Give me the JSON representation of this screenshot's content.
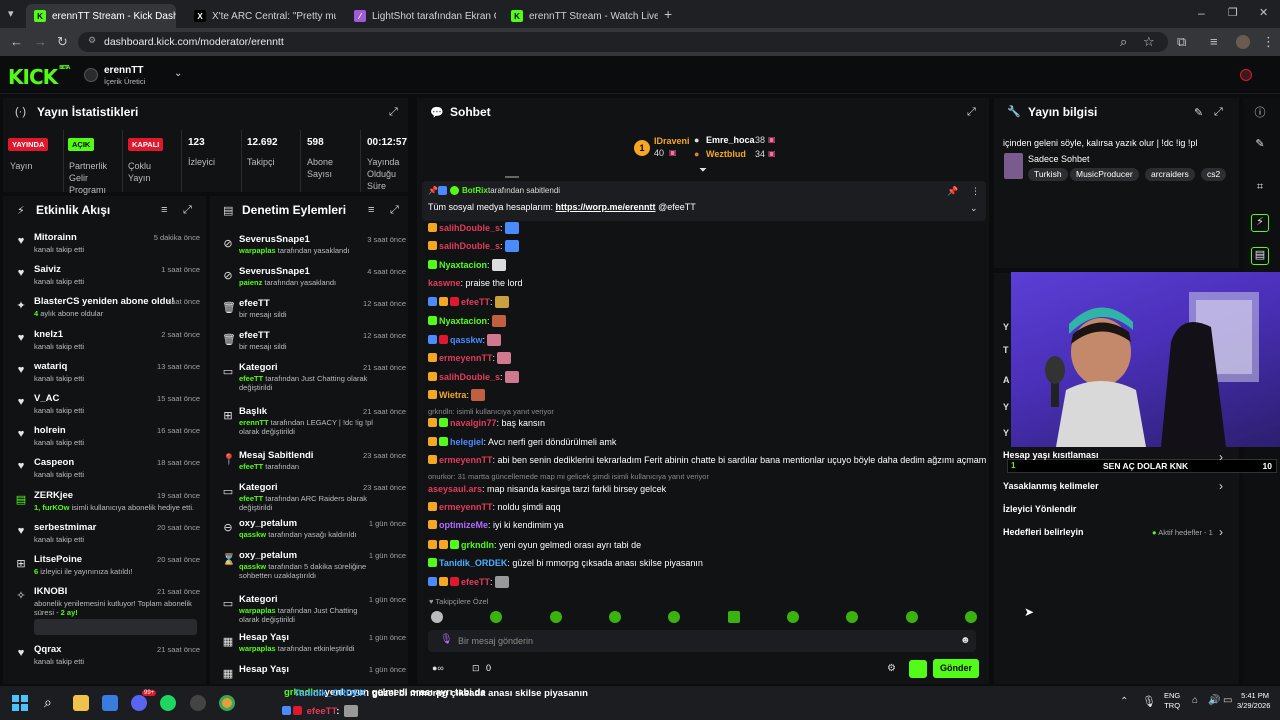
{
  "browser": {
    "tabs": [
      {
        "label": "erennTT Stream - Kick Dashbo",
        "favicon": "kick-icon",
        "active": true
      },
      {
        "label": "X'te ARC Central: \"Pretty much",
        "favicon": "x-icon",
        "active": false
      },
      {
        "label": "LightShot tarafından Ekran Gön",
        "favicon": "lightshot-icon",
        "active": false
      },
      {
        "label": "erennTT Stream - Watch Live o",
        "favicon": "kick-icon",
        "active": false
      }
    ],
    "url": "dashboard.kick.com/moderator/erenntt"
  },
  "header": {
    "logo": "KICK",
    "logo_super": "BETA",
    "channel_name": "erennTT",
    "channel_role": "İçerik Üretici"
  },
  "stats": {
    "title": "Yayın İstatistikleri",
    "items": [
      {
        "badge": "YAYINDA",
        "label": "Yayın",
        "badge_color": "#e0182d"
      },
      {
        "badge": "AÇIK",
        "label": "Partnerlik Gelir Programı",
        "badge_color": "#53fc18"
      },
      {
        "badge": "KAPALI",
        "label": "Çoklu Yayın",
        "badge_color": "#e0182d"
      },
      {
        "value": "123",
        "label": "İzleyici"
      },
      {
        "value": "12.692",
        "label": "Takipçi"
      },
      {
        "value": "598",
        "label": "Abone Sayısı"
      },
      {
        "value": "00:12:57",
        "label": "Yayında Olduğu Süre"
      }
    ]
  },
  "activity": {
    "title": "Etkinlik Akışı",
    "items": [
      {
        "icon": "heart-icon",
        "name": "Mitorainn",
        "sub": "kanalı takip etti",
        "time": "5 dakika önce"
      },
      {
        "icon": "heart-icon",
        "name": "Saiviz",
        "sub": "kanalı takip etti",
        "time": "1 saat önce"
      },
      {
        "icon": "star-icon",
        "name": "BlasterCS yeniden abone oldu!",
        "sub_count": "4",
        "sub": " aylık abone oldular",
        "time": "1 saat önce"
      },
      {
        "icon": "heart-icon",
        "name": "knelz1",
        "sub": "kanalı takip etti",
        "time": "2 saat önce"
      },
      {
        "icon": "heart-icon",
        "name": "watariq",
        "sub": "kanalı takip etti",
        "time": "13 saat önce"
      },
      {
        "icon": "heart-icon",
        "name": "V_AC",
        "sub": "kanalı takip etti",
        "time": "15 saat önce"
      },
      {
        "icon": "heart-icon",
        "name": "holrein",
        "sub": "kanalı takip etti",
        "time": "16 saat önce"
      },
      {
        "icon": "heart-icon",
        "name": "Caspeon",
        "sub": "kanalı takip etti",
        "time": "18 saat önce"
      },
      {
        "icon": "gift-icon",
        "name": "ZERKjee",
        "sub_count": "1, furKOw",
        "sub": " isimli kullanıcıya abonelik hediye etti.",
        "time": "19 saat önce"
      },
      {
        "icon": "heart-icon",
        "name": "serbestmimar",
        "sub": "kanalı takip etti",
        "time": "20 saat önce"
      },
      {
        "icon": "host-icon",
        "name": "LitsePoine",
        "sub_count": "6",
        "sub": " izleyici ile yayınınıza katıldı!",
        "time": "20 saat önce"
      },
      {
        "icon": "sparkle-icon",
        "name": "IKNOBI",
        "sub": "abonelik yenilemesini kutluyor! Toplam abonelik süresi - ",
        "sub_count": "2 ay!",
        "time": "21 saat önce"
      },
      {
        "icon": "heart-icon",
        "name": "Qqrax",
        "sub": "kanalı takip etti",
        "time": "21 saat önce"
      }
    ]
  },
  "moderation": {
    "title": "Denetim Eylemleri",
    "items": [
      {
        "icon": "ban-icon",
        "name": "SeverusSnape1",
        "actor": "warpaplas",
        "sub": " tarafından yasaklandı",
        "time": "3 saat önce"
      },
      {
        "icon": "ban-icon",
        "name": "SeverusSnape1",
        "actor": "paienz",
        "sub": " tarafından yasaklandı",
        "time": "4 saat önce"
      },
      {
        "icon": "trash-icon",
        "name": "efeeTT",
        "actor": "",
        "sub": "bir mesajı sildi",
        "time": "12 saat önce"
      },
      {
        "icon": "trash-icon",
        "name": "efeeTT",
        "actor": "",
        "sub": "bir mesajı sildi",
        "time": "12 saat önce"
      },
      {
        "icon": "category-icon",
        "name": "Kategori",
        "actor": "efeeTT",
        "sub": " tarafından Just Chatting olarak değiştirildi",
        "time": "21 saat önce"
      },
      {
        "icon": "title-icon",
        "name": "Başlık",
        "actor": "erennTT",
        "sub": " tarafından LEGACY | !dc !ig !pl olarak değiştirildi",
        "time": "21 saat önce"
      },
      {
        "icon": "pin-icon",
        "name": "Mesaj Sabitlendi",
        "actor": "efeeTT",
        "sub": " tarafından",
        "time": "23 saat önce"
      },
      {
        "icon": "category-icon",
        "name": "Kategori",
        "actor": "efeeTT",
        "sub": " tarafından ARC Raiders olarak değiştirildi",
        "time": "23 saat önce"
      },
      {
        "icon": "unban-icon",
        "name": "oxy_petalum",
        "actor": "qasskw",
        "sub": " tarafından yasağı kaldırıldı",
        "time": "1 gün önce"
      },
      {
        "icon": "timeout-icon",
        "name": "oxy_petalum",
        "actor": "qasskw",
        "sub": " tarafından 5 dakika süreliğine sohbetten uzaklaştırıldı",
        "time": "1 gün önce"
      },
      {
        "icon": "category-icon",
        "name": "Kategori",
        "actor": "warpaplas",
        "sub": " tarafından Just Chatting olarak değiştirildi",
        "time": "1 gün önce"
      },
      {
        "icon": "calendar-icon",
        "name": "Hesap Yaşı",
        "actor": "warpaplas",
        "sub": " tarafından etkinleştirildi",
        "time": "1 gün önce"
      },
      {
        "icon": "calendar-icon",
        "name": "Hesap Yaşı",
        "actor": "",
        "sub": "",
        "time": "1 gün önce"
      }
    ]
  },
  "chat": {
    "title": "Sohbet",
    "leaderboard": [
      {
        "rank": "1",
        "name": "IDraveni",
        "value": "40"
      },
      {
        "name": "Emre_hoca",
        "value": "38"
      },
      {
        "name": "Weztblud",
        "value": "34"
      }
    ],
    "pinned": {
      "by": "BotRix",
      "by_suffix": " tarafından sabitlendi",
      "text": "Tüm sosyal medya hesaplarım: ",
      "link": "https://worp.me/erenntt",
      "mention": " @efeeTT"
    },
    "messages": [
      {
        "user": "salihDouble_s",
        "color": "#e23a5b",
        "text": ":"
      },
      {
        "user": "salihDouble_s",
        "color": "#e23a5b",
        "text": ":"
      },
      {
        "user": "Nyaxtacion",
        "color": "#53fc18",
        "text": ":"
      },
      {
        "user": "kaswne",
        "color": "#e23a5b",
        "text": ": praise the lord"
      },
      {
        "user": "efeeTT",
        "color": "#e23a5b",
        "text": ":"
      },
      {
        "user": "Nyaxtacion",
        "color": "#53fc18",
        "text": ":"
      },
      {
        "user": "qasskw",
        "color": "#4a8cff",
        "text": ":"
      },
      {
        "user": "ermeyennTT",
        "color": "#e23a5b",
        "text": ":"
      },
      {
        "user": "salihDouble_s",
        "color": "#e23a5b",
        "text": ":"
      },
      {
        "user": "Wietra",
        "color": "#f5a623",
        "text": ":"
      },
      {
        "reply": "grkndln: isimli kullanıcıya yanıt veriyor"
      },
      {
        "user": "navalgin77",
        "color": "#e23a5b",
        "text": ": baş kansın"
      },
      {
        "user": "helegiel",
        "color": "#4a8cff",
        "text": ": Avcı nerfi geri döndürülmeli amk"
      },
      {
        "user": "ermeyennTT",
        "color": "#e23a5b",
        "text": ": abi ben senin dediklerini tekrarladım Ferit abinin chatte bi sardılar bana mentionlar uçuyo böyle daha dedim ağzımı açmam"
      },
      {
        "reply": "onurkor: 31 martta güncellemede map mi gelicek şimdi isimli kullanıcıya yanıt veriyor"
      },
      {
        "user": "aseysaul.ars",
        "color": "#e23a5b",
        "text": ": map nisanda kasirga tarzi farkli birsey gelcek"
      },
      {
        "user": "ermeyennTT",
        "color": "#e23a5b",
        "text": ": noldu şimdi aqq"
      },
      {
        "user": "optimizeMe",
        "color": "#b06cff",
        "text": ": iyi ki kendimim ya"
      },
      {
        "user": "grkndln",
        "color": "#53fc18",
        "text": ": yeni oyun gelmedi orası ayrı tabi de"
      },
      {
        "user": "Tanidik_ORDEK",
        "color": "#4ab0ff",
        "text": ": güzel bi mmorpg çıksada anası skilse piyasanın"
      },
      {
        "user": "efeeTT",
        "color": "#e23a5b",
        "text": ":"
      }
    ],
    "followers_only": "Takipçilere Özel",
    "input_placeholder": "Bir mesaj gönderin",
    "kicks_count": "0",
    "send_label": "Gönder"
  },
  "stream_info": {
    "title": "Yayın bilgisi",
    "stream_title": "içinden geleni söyle, kalırsa yazık olur | !dc !ig !pl",
    "category": "Sadece Sohbet",
    "tags": [
      "Turkish",
      "MusicProducer",
      "arcraiders",
      "cs2"
    ]
  },
  "settings": {
    "account_age": "Hesap yaşı kısıtlaması",
    "banned_words": "Yasaklanmış kelimeler",
    "redirect": "İzleyici Yönlendir",
    "goals": "Hedefleri belirleyin",
    "goals_status": "Aktif hedefler - 1"
  },
  "overlay": {
    "goal_label": "SEN AÇ DOLAR KNK",
    "goal_value": "10",
    "goal_left": "1"
  },
  "bottom_overlay": {
    "lines": [
      {
        "user": "grkndln",
        "text": ": yeni oyun gelmedi orası ayrı tabi de"
      },
      {
        "user": "Tanidik_ORDEK",
        "text": ": güzel bi mmorpg çıksada anası skilse piyasanın"
      },
      {
        "user": "efeeTT",
        "text": ":"
      }
    ]
  },
  "taskbar": {
    "lang_top": "ENG",
    "lang_bottom": "TRQ",
    "time": "5:41 PM",
    "date": "3/29/2026",
    "badge_count": "99+"
  }
}
